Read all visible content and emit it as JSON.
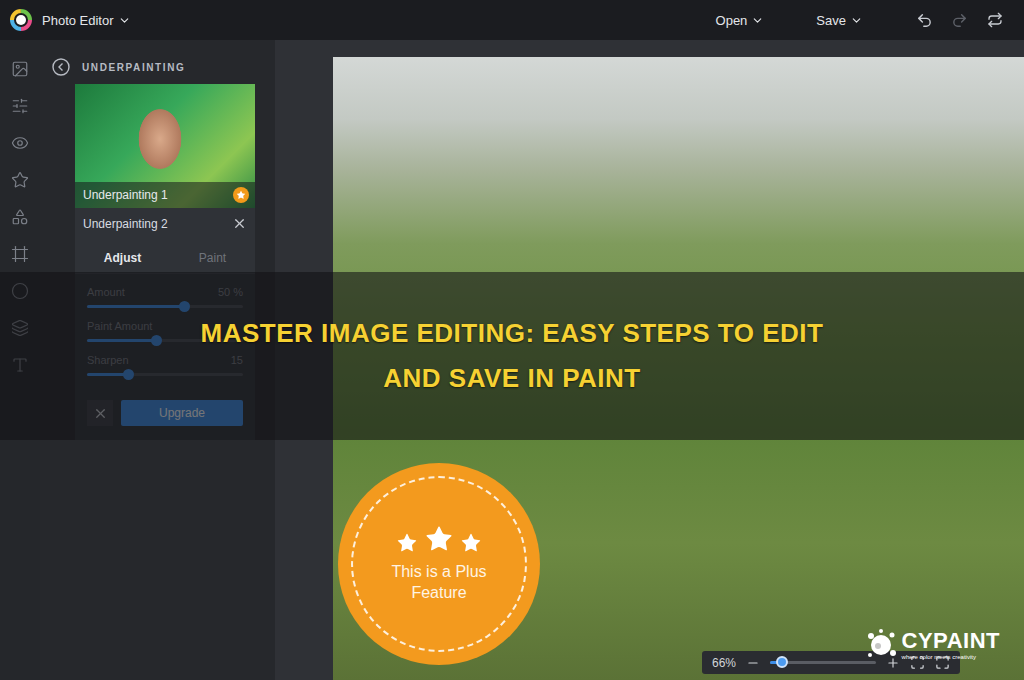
{
  "topbar": {
    "app_title": "Photo Editor",
    "menus": [
      {
        "label": "Open"
      },
      {
        "label": "Save"
      }
    ]
  },
  "panel": {
    "title": "UNDERPAINTING",
    "presets": [
      {
        "label": "Underpainting 1",
        "selected": false,
        "premium": true
      },
      {
        "label": "Underpainting 2",
        "selected": true,
        "premium": false
      }
    ],
    "tabs": [
      {
        "label": "Adjust",
        "selected": true
      },
      {
        "label": "Paint",
        "selected": false
      }
    ],
    "sliders": [
      {
        "label": "Amount",
        "level": 0.62,
        "reading": "50 %"
      },
      {
        "label": "Paint Amount",
        "level": 0.44
      },
      {
        "label": "Sharpen",
        "level": 0.26,
        "reading": "15"
      }
    ],
    "upgrade_button": "Upgrade"
  },
  "canvas": {
    "badge": "This is a Plus Feature",
    "zoom": {
      "reading": "66%",
      "level": 0.11
    }
  },
  "overlay": {
    "headline": [
      "MASTER IMAGE EDITING: EASY STEPS TO EDIT",
      "AND SAVE IN PAINT"
    ]
  },
  "watermark": {
    "brand": "CYPAINT",
    "tagline": "where color meets creativity"
  }
}
